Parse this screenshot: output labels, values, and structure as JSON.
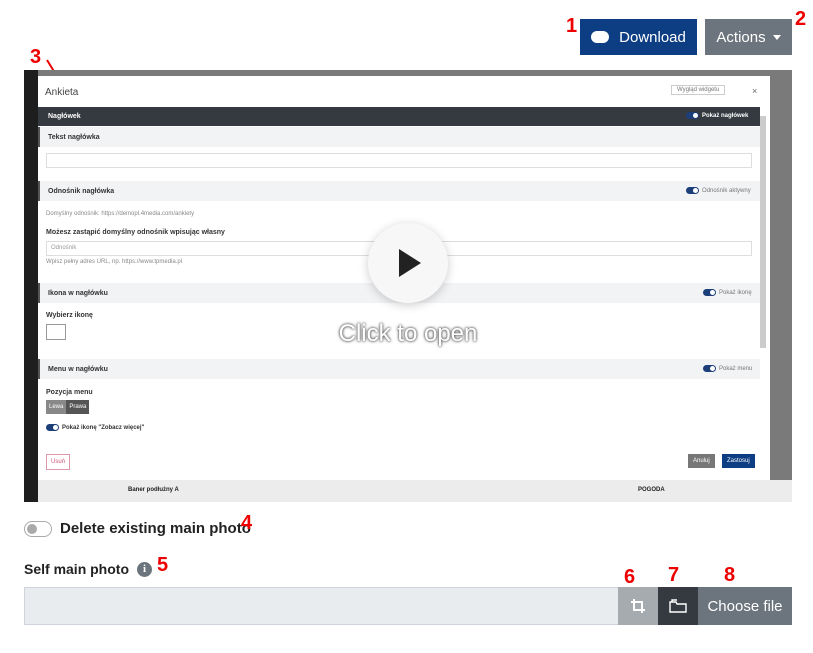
{
  "toolbar": {
    "download_label": "Download",
    "actions_label": "Actions"
  },
  "markers": [
    "1",
    "2",
    "3",
    "4",
    "5",
    "6",
    "7",
    "8"
  ],
  "video": {
    "overlay_text": "Click to open",
    "dialog": {
      "title": "Ankieta",
      "widget_button": "Wygląd widgetu",
      "close": "×",
      "header_bar": "Nagłówek",
      "show_header": "Pokaż nagłówek",
      "sec_text": "Tekst nagłówka",
      "sec_link": "Odnośnik nagłówka",
      "link_active": "Odnośnik aktywny",
      "default_link": "Domyślny odnośnik: https://demopl.4media.com/ankiety",
      "override_label": "Możesz zastąpić domyślny odnośnik wpisując własny",
      "link_placeholder": "Odnośnik",
      "link_hint": "Wpisz pełny adres URL, np. https://www.tpmedia.pl",
      "sec_icon": "Ikona w nagłówku",
      "show_icon": "Pokaż ikonę",
      "choose_icon": "Wybierz ikonę",
      "sec_menu": "Menu w nagłówku",
      "show_menu": "Pokaż menu",
      "menu_position": "Pozycja menu",
      "left": "Lewa",
      "right": "Prawa",
      "show_more_icon": "Pokaż ikonę \"Zobacz więcej\"",
      "delete": "Usuń",
      "cancel": "Anuluj",
      "apply": "Zastosuj"
    },
    "background": {
      "banner": "Baner podłużny A",
      "weather": "POGODA"
    }
  },
  "form": {
    "delete_label": "Delete existing main photo",
    "delete_checked": false,
    "photo_label": "Self main photo",
    "choose_file": "Choose file",
    "file_value": ""
  }
}
